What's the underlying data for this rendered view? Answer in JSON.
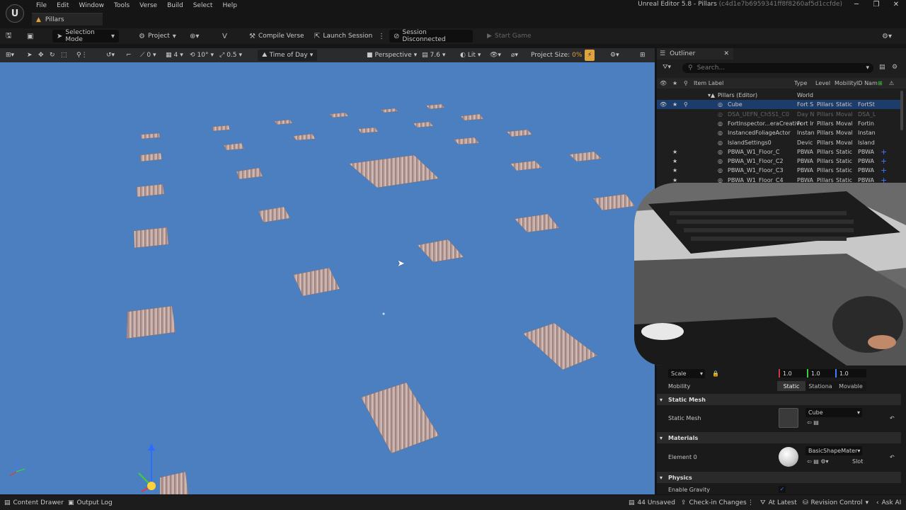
{
  "app": {
    "title": "Unreal Editor 5.8 - Pillars",
    "hash": "(c4d1e7b6959341ff8f8260af5d1ccfde)",
    "logo_icon": "unreal-logo",
    "menu": [
      "File",
      "Edit",
      "Window",
      "Tools",
      "Verse",
      "Build",
      "Select",
      "Help"
    ],
    "doc_tab": "Pillars"
  },
  "toolbar": {
    "selection_mode": "Selection Mode",
    "project": "Project",
    "compile_verse": "Compile Verse",
    "launch_session": "Launch Session",
    "session_status": "Session Disconnected",
    "start_game": "Start Game"
  },
  "viewport_toolbar": {
    "snap_rotate": "0",
    "grid": "4",
    "rotate_snap": "10°",
    "scale_snap": "0.5",
    "time_of_day": "Time of Day",
    "perspective": "Perspective",
    "cam_speed": "7.6",
    "lit": "Lit",
    "project_size_label": "Project Size:",
    "project_size_value": "0%"
  },
  "outliner": {
    "tab": "Outliner",
    "search_placeholder": "Search...",
    "columns": [
      "Item Label",
      "Type",
      "Level",
      "Mobility",
      "ID Nam"
    ],
    "rows": [
      {
        "label": "Pillars (Editor)",
        "type": "World",
        "level": "",
        "mobility": "",
        "id": "",
        "indent": 1,
        "selected": false,
        "gray": false,
        "star": false,
        "eye": false
      },
      {
        "label": "Cube",
        "type": "Fort S",
        "level": "Pillars",
        "mobility": "Static",
        "id": "FortSt",
        "indent": 2,
        "selected": true,
        "gray": false,
        "star": true,
        "eye": true
      },
      {
        "label": "DSA_UEFN_Ch5S1_C0",
        "type": "Day N",
        "level": "Pillars",
        "mobility": "Moval",
        "id": "DSA_L",
        "indent": 2,
        "selected": false,
        "gray": true,
        "star": false,
        "eye": false
      },
      {
        "label": "FortInspector...eraCreative1",
        "type": "Fort Ir",
        "level": "Pillars",
        "mobility": "Moval",
        "id": "Fortin",
        "indent": 2,
        "selected": false,
        "gray": false,
        "star": false,
        "eye": false
      },
      {
        "label": "InstancedFoliageActor",
        "type": "Instan",
        "level": "Pillars",
        "mobility": "Moval",
        "id": "Instan",
        "indent": 2,
        "selected": false,
        "gray": false,
        "star": false,
        "eye": false
      },
      {
        "label": "IslandSettings0",
        "type": "Devic",
        "level": "Pillars",
        "mobility": "Moval",
        "id": "Island",
        "indent": 2,
        "selected": false,
        "gray": false,
        "star": false,
        "eye": false
      },
      {
        "label": "PBWA_W1_Floor_C",
        "type": "PBWA",
        "level": "Pillars",
        "mobility": "Static",
        "id": "PBWA",
        "indent": 2,
        "selected": false,
        "gray": false,
        "star": true,
        "eye": false
      },
      {
        "label": "PBWA_W1_Floor_C2",
        "type": "PBWA",
        "level": "Pillars",
        "mobility": "Static",
        "id": "PBWA",
        "indent": 2,
        "selected": false,
        "gray": false,
        "star": true,
        "eye": false
      },
      {
        "label": "PBWA_W1_Floor_C3",
        "type": "PBWA",
        "level": "Pillars",
        "mobility": "Static",
        "id": "PBWA",
        "indent": 2,
        "selected": false,
        "gray": false,
        "star": true,
        "eye": false
      },
      {
        "label": "PBWA_W1_Floor_C4",
        "type": "PBWA",
        "level": "Pillars",
        "mobility": "Static",
        "id": "PBWA",
        "indent": 2,
        "selected": false,
        "gray": false,
        "star": true,
        "eye": false
      }
    ]
  },
  "details": {
    "scale_label": "Scale",
    "scale_values": [
      "1.0",
      "1.0",
      "1.0"
    ],
    "mobility_label": "Mobility",
    "mobility_options": [
      "Static",
      "Stationa",
      "Movable"
    ],
    "mobility_selected": "Static",
    "static_mesh_section": "Static Mesh",
    "static_mesh_label": "Static Mesh",
    "static_mesh_value": "Cube",
    "materials_section": "Materials",
    "element0_label": "Element 0",
    "element0_value": "BasicShapeMater",
    "slot_label": "Slot",
    "physics_section": "Physics",
    "enable_gravity_label": "Enable Gravity"
  },
  "status_bar": {
    "content_drawer": "Content Drawer",
    "output_log": "Output Log",
    "unsaved": "44 Unsaved",
    "check_in": "Check-in Changes",
    "at_latest": "At Latest",
    "revision_control": "Revision Control",
    "ask_ai": "Ask AI"
  },
  "colors": {
    "viewport_bg": "#4b7fbf",
    "selection": "#1c3d6b",
    "accent": "#e1a33c"
  }
}
